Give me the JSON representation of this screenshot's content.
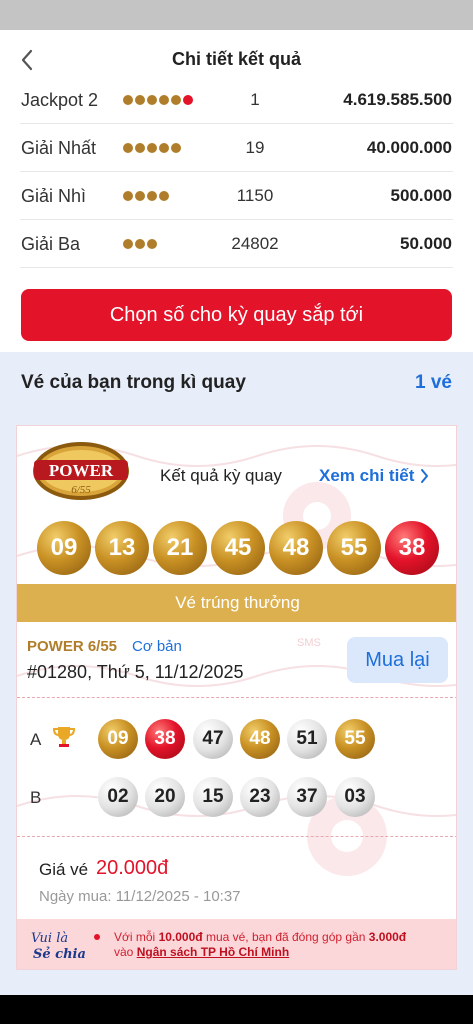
{
  "header": {
    "title": "Chi tiết kết quả",
    "back_icon": "chevron-left-icon"
  },
  "prizes": [
    {
      "name": "Jackpot 2",
      "gold_dots": 5,
      "red_dots": 1,
      "winners": "1",
      "amount": "4.619.585.500"
    },
    {
      "name": "Giải Nhất",
      "gold_dots": 5,
      "red_dots": 0,
      "winners": "19",
      "amount": "40.000.000"
    },
    {
      "name": "Giải Nhì",
      "gold_dots": 4,
      "red_dots": 0,
      "winners": "1150",
      "amount": "500.000"
    },
    {
      "name": "Giải Ba",
      "gold_dots": 3,
      "red_dots": 0,
      "winners": "24802",
      "amount": "50.000"
    }
  ],
  "pick_button": "Chọn số cho kỳ quay sắp tới",
  "tickets": {
    "title": "Vé của bạn trong kì quay",
    "count": "1 vé"
  },
  "ticket": {
    "logo_text": "POWER",
    "logo_sub": "6/55",
    "result_label": "Kết quả kỳ quay",
    "detail_link": "Xem chi tiết",
    "result_numbers": [
      "09",
      "13",
      "21",
      "45",
      "48",
      "55",
      "38"
    ],
    "win_banner": "Vé trúng thưởng",
    "game_name": "POWER 6/55",
    "game_type": "Cơ bản",
    "draw_info": "#01280,  Thứ 5, 11/12/2025",
    "rebuy_label": "Mua lại",
    "rows": [
      {
        "letter": "A",
        "numbers": [
          "09",
          "38",
          "47",
          "48",
          "51",
          "55"
        ],
        "styles": [
          "gold",
          "red",
          "silver",
          "gold",
          "silver",
          "gold"
        ]
      },
      {
        "letter": "B",
        "numbers": [
          "02",
          "20",
          "15",
          "23",
          "37",
          "03"
        ],
        "styles": [
          "silver",
          "silver",
          "silver",
          "silver",
          "silver",
          "silver"
        ]
      }
    ],
    "price_label": "Giá vé",
    "price_value": "20.000đ",
    "buy_date": "Ngày mua: 11/12/2025 - 10:37",
    "footer_logo_line1": "Vui là",
    "footer_logo_line2": "Sẻ chia",
    "footer_prefix": "Với mỗi",
    "footer_amount1": "10.000đ",
    "footer_middle": "mua vé, bạn đã đóng góp gần",
    "footer_amount2": "3.000đ",
    "footer_vao": "vào",
    "footer_link": "Ngân sách TP Hồ Chí Minh"
  },
  "colors": {
    "accent_red": "#e3132a",
    "link_blue": "#1e6fd9",
    "gold": "#b07e2a",
    "banner_gold": "#dcb04f"
  }
}
